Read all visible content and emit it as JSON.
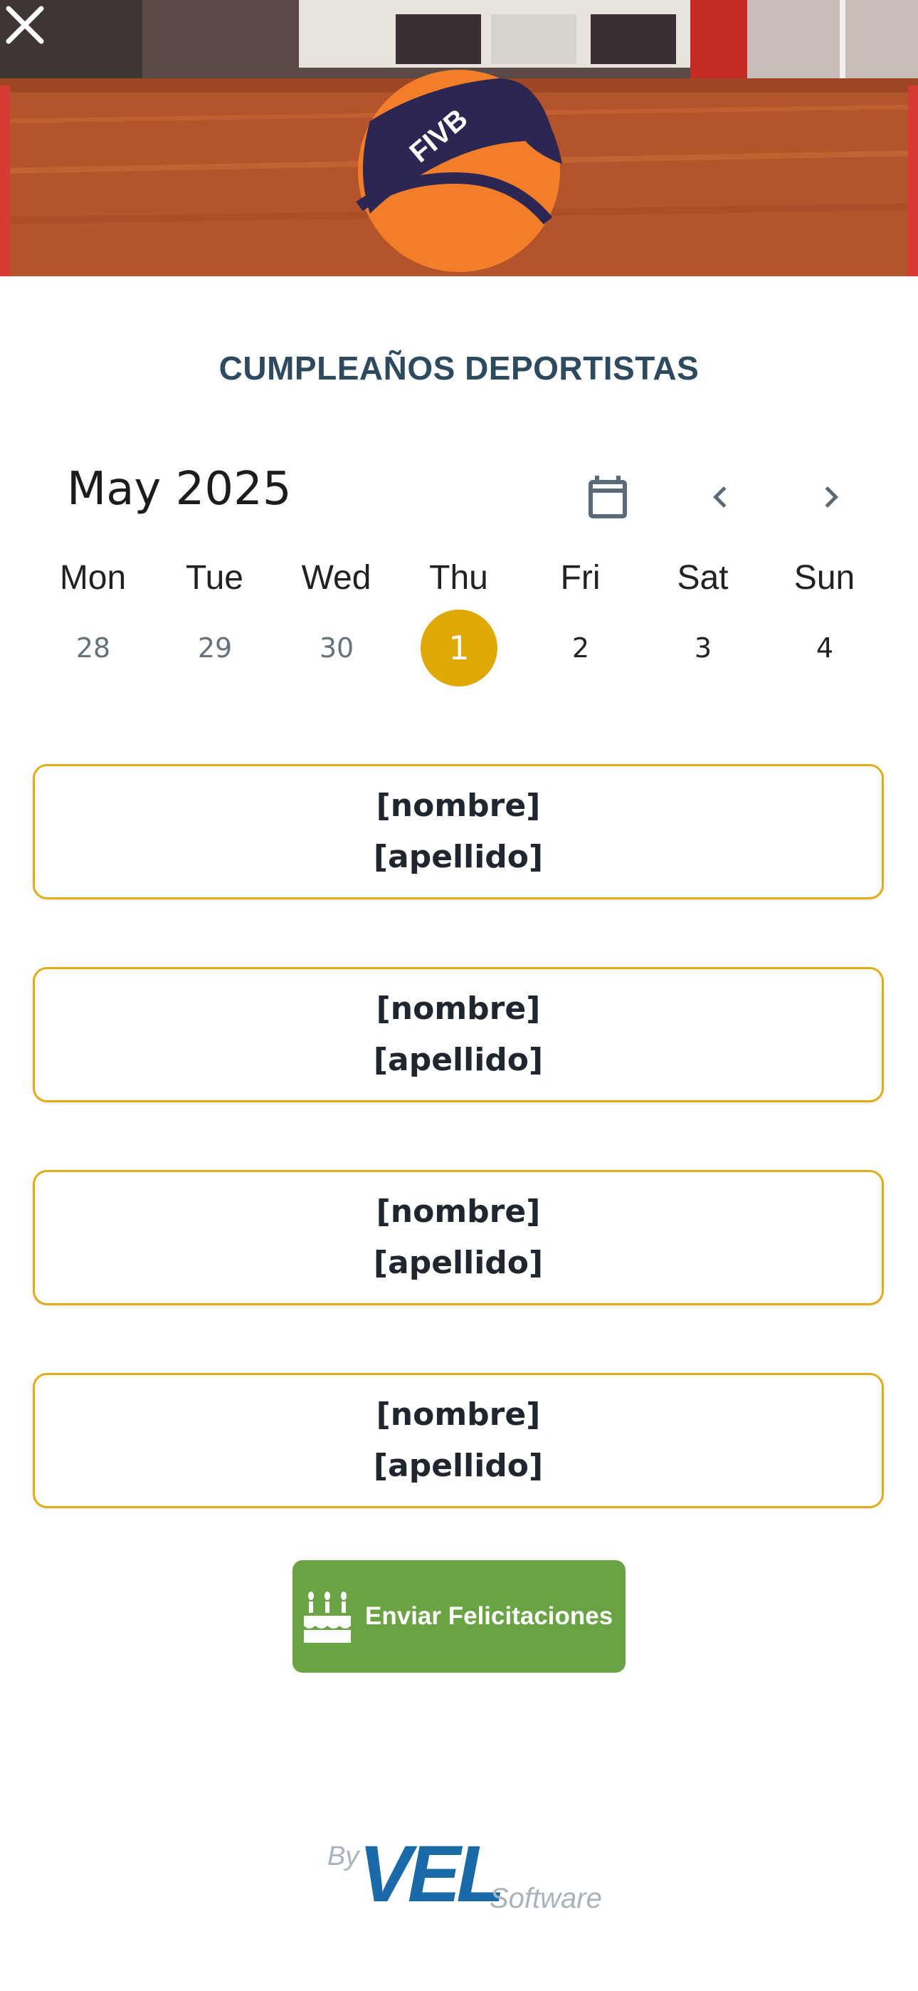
{
  "header": {
    "title": "CUMPLEAÑOS DEPORTISTAS",
    "close_icon": "close-icon"
  },
  "calendar": {
    "month_label": "May 2025",
    "icons": {
      "calendar": "calendar-icon",
      "prev": "chevron-left-icon",
      "next": "chevron-right-icon"
    },
    "weekdays": [
      "Mon",
      "Tue",
      "Wed",
      "Thu",
      "Fri",
      "Sat",
      "Sun"
    ],
    "days": [
      "28",
      "29",
      "30",
      "1",
      "2",
      "3",
      "4"
    ],
    "selected_day": "1",
    "selected_color": "#e0a805"
  },
  "birthdays": [
    {
      "first_name": "[nombre]",
      "last_name": "[apellido]"
    },
    {
      "first_name": "[nombre]",
      "last_name": "[apellido]"
    },
    {
      "first_name": "[nombre]",
      "last_name": "[apellido]"
    },
    {
      "first_name": "[nombre]",
      "last_name": "[apellido]"
    }
  ],
  "actions": {
    "send_label": "Enviar Felicitaciones",
    "send_icon": "cake-icon",
    "send_color": "#6aa343"
  },
  "footer": {
    "by": "By",
    "brand": "VEL",
    "software": "Software"
  },
  "colors": {
    "title": "#2d4a5e",
    "card_border": "#e2ac18",
    "brand_blue": "#1a6aa8"
  }
}
